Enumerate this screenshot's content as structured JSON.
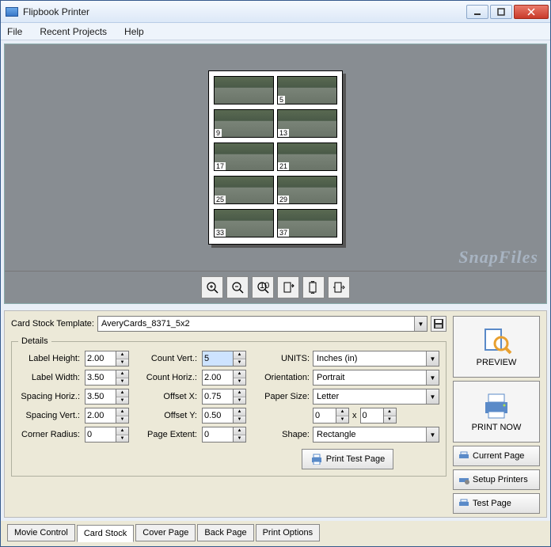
{
  "window": {
    "title": "Flipbook Printer"
  },
  "menu": {
    "file": "File",
    "recent": "Recent Projects",
    "help": "Help"
  },
  "watermark": "SnapFiles",
  "page_cards": [
    "",
    "5",
    "9",
    "13",
    "17",
    "21",
    "25",
    "29",
    "33",
    "37"
  ],
  "template": {
    "label": "Card Stock Template:",
    "value": "AveryCards_8371_5x2"
  },
  "details": {
    "legend": "Details",
    "label_height": {
      "label": "Label Height:",
      "value": "2.00"
    },
    "label_width": {
      "label": "Label Width:",
      "value": "3.50"
    },
    "spacing_horiz": {
      "label": "Spacing Horiz.:",
      "value": "3.50"
    },
    "spacing_vert": {
      "label": "Spacing Vert.:",
      "value": "2.00"
    },
    "corner_radius": {
      "label": "Corner Radius:",
      "value": "0"
    },
    "count_vert": {
      "label": "Count Vert.:",
      "value": "5"
    },
    "count_horiz": {
      "label": "Count Horiz.:",
      "value": "2.00"
    },
    "offset_x": {
      "label": "Offset X:",
      "value": "0.75"
    },
    "offset_y": {
      "label": "Offset Y:",
      "value": "0.50"
    },
    "page_extent": {
      "label": "Page Extent:",
      "value": "0"
    },
    "units": {
      "label": "UNITS:",
      "value": "Inches (in)"
    },
    "orientation": {
      "label": "Orientation:",
      "value": "Portrait"
    },
    "paper_size": {
      "label": "Paper Size:",
      "value": "Letter",
      "w": "0",
      "h": "0",
      "x": "x"
    },
    "shape": {
      "label": "Shape:",
      "value": "Rectangle"
    },
    "print_test": "Print Test Page"
  },
  "actions": {
    "preview": "PREVIEW",
    "print_now": "PRINT NOW",
    "current_page": "Current Page",
    "setup_printers": "Setup Printers",
    "test_page": "Test Page"
  },
  "tabs": {
    "movie": "Movie Control",
    "cardstock": "Card Stock",
    "cover": "Cover Page",
    "back": "Back Page",
    "print": "Print Options"
  }
}
